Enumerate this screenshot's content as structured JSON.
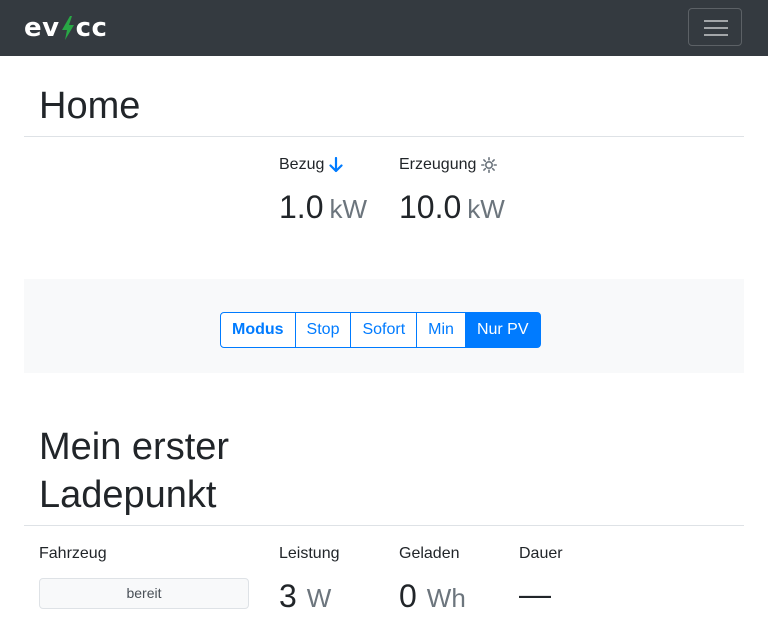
{
  "navbar": {
    "brand_left": "ev",
    "brand_right": "cc",
    "bolt_color": "#28a745",
    "menu_icon": "hamburger-icon"
  },
  "home": {
    "title": "Home",
    "bezug": {
      "label": "Bezug",
      "icon": "arrow-down-icon",
      "value": "1.0",
      "unit": "kW"
    },
    "erzeugung": {
      "label": "Erzeugung",
      "icon": "sun-icon",
      "value": "10.0",
      "unit": "kW"
    }
  },
  "mode": {
    "label": "Modus",
    "options": [
      "Stop",
      "Sofort",
      "Min",
      "Nur PV"
    ],
    "selected": "Nur PV"
  },
  "loadpoint": {
    "title_line1": "Mein erster",
    "title_line2": "Ladepunkt",
    "fahrzeug": {
      "label": "Fahrzeug",
      "status": "bereit"
    },
    "leistung": {
      "label": "Leistung",
      "value": "3",
      "unit": "W"
    },
    "geladen": {
      "label": "Geladen",
      "value": "0",
      "unit": "Wh"
    },
    "dauer": {
      "label": "Dauer",
      "value": "—"
    }
  },
  "colors": {
    "primary": "#007bff",
    "navbar": "#343a40",
    "muted": "#6c757d"
  }
}
